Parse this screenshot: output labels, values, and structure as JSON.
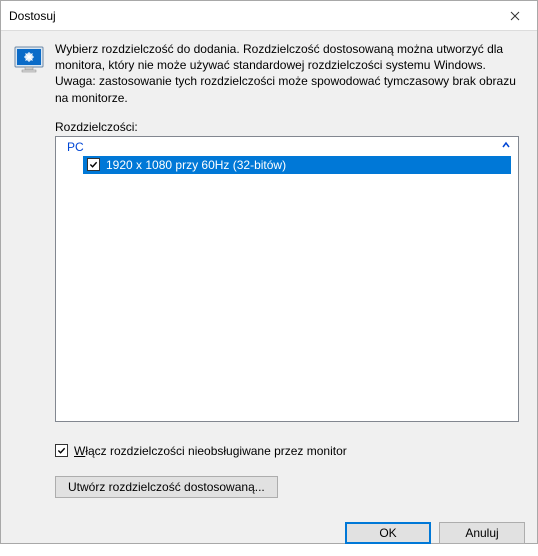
{
  "window": {
    "title": "Dostosuj"
  },
  "description": "Wybierz rozdzielczość do dodania. Rozdzielczość dostosowaną można utworzyć dla monitora, który nie może używać standardowej rozdzielczości systemu Windows. Uwaga: zastosowanie tych rozdzielczości może spowodować tymczasowy brak obrazu na monitorze.",
  "list": {
    "label": "Rozdzielczości:",
    "group": "PC",
    "items": [
      {
        "checked": true,
        "label": "1920 x 1080 przy 60Hz (32-bitów)",
        "selected": true
      }
    ]
  },
  "enable_unsupported": {
    "checked": true,
    "label": "Włącz rozdzielczości nieobsługiwane przez monitor"
  },
  "buttons": {
    "create": "Utwórz rozdzielczość dostosowaną...",
    "ok": "OK",
    "cancel": "Anuluj"
  }
}
